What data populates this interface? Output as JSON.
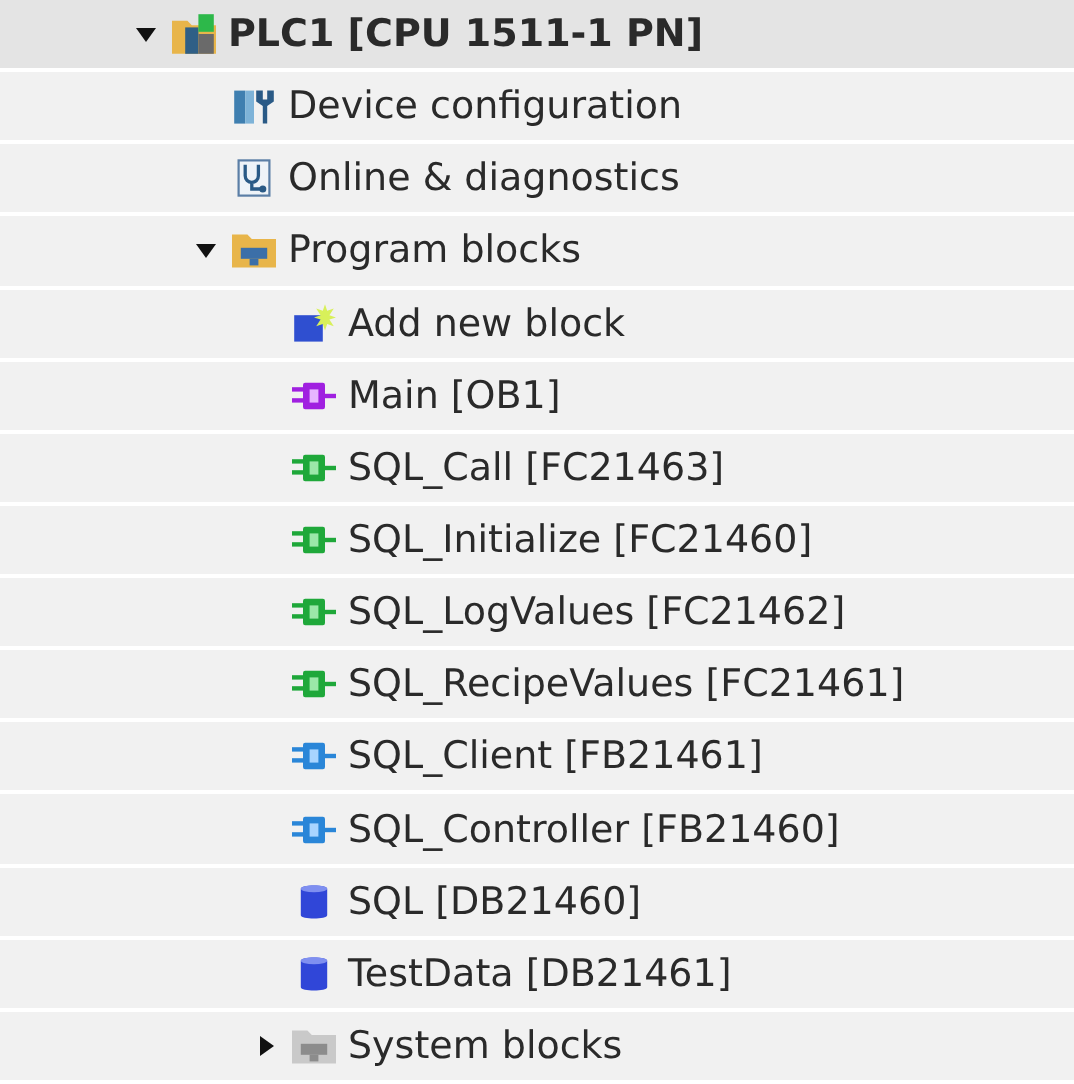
{
  "tree": [
    {
      "label": "PLC1 [CPU 1511-1 PN]",
      "kind": "plc",
      "expanded": true,
      "children": [
        {
          "label": "Device configuration",
          "kind": "device"
        },
        {
          "label": "Online & diagnostics",
          "kind": "online"
        },
        {
          "label": "Program blocks",
          "kind": "folder",
          "expanded": true,
          "children": [
            {
              "label": "Add new block",
              "kind": "add"
            },
            {
              "label": "Main [OB1]",
              "kind": "ob"
            },
            {
              "label": "SQL_Call [FC21463]",
              "kind": "fc"
            },
            {
              "label": "SQL_Initialize [FC21460]",
              "kind": "fc"
            },
            {
              "label": "SQL_LogValues [FC21462]",
              "kind": "fc"
            },
            {
              "label": "SQL_RecipeValues [FC21461]",
              "kind": "fc"
            },
            {
              "label": "SQL_Client [FB21461]",
              "kind": "fb"
            },
            {
              "label": "SQL_Controller [FB21460]",
              "kind": "fb"
            },
            {
              "label": "SQL [DB21460]",
              "kind": "db"
            },
            {
              "label": "TestData [DB21461]",
              "kind": "db"
            },
            {
              "label": "System blocks",
              "kind": "sysfolder",
              "expanded": false
            }
          ]
        }
      ]
    }
  ]
}
